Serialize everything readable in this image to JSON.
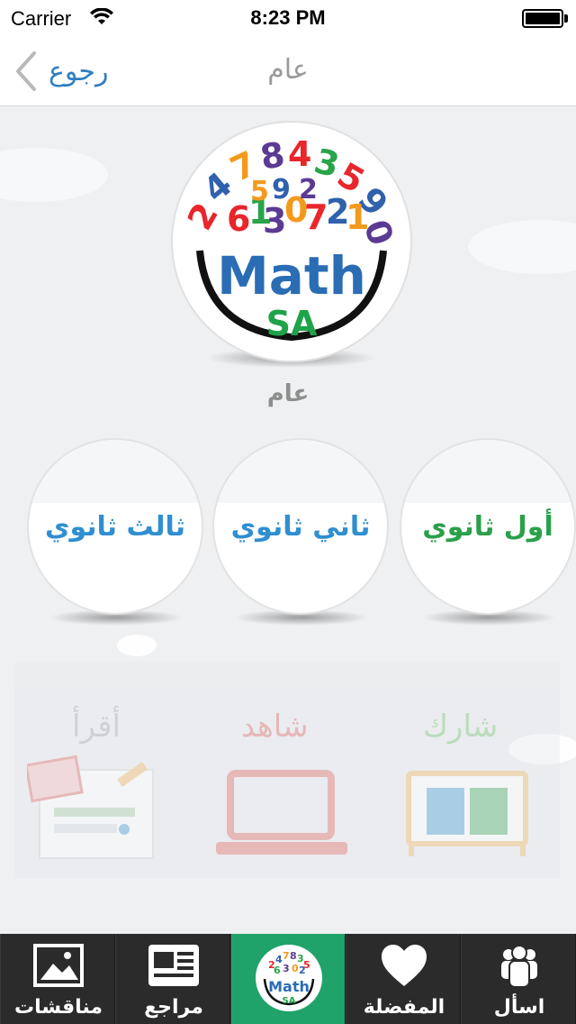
{
  "status_bar": {
    "carrier": "Carrier",
    "time": "8:23 PM"
  },
  "nav": {
    "back_label": "رجوع",
    "title": "عام"
  },
  "logo": {
    "math_text": "Math",
    "sa_text": "SA",
    "digits": "247843590"
  },
  "section_caption": "عام",
  "grades": [
    {
      "label": "ثالث ثانوي",
      "color": "#2f8fd1"
    },
    {
      "label": "ثاني ثانوي",
      "color": "#2f8fd1"
    },
    {
      "label": "أول ثانوي",
      "color": "#2ba04b"
    }
  ],
  "faded_features": [
    {
      "label": "أقرأ",
      "color": "#9a9a9a"
    },
    {
      "label": "شاهد",
      "color": "#d9534f"
    },
    {
      "label": "شارك",
      "color": "#5cb85c"
    }
  ],
  "tabbar": {
    "items": [
      {
        "label": "مناقشات",
        "icon": "image-icon"
      },
      {
        "label": "مراجع",
        "icon": "newspaper-icon"
      },
      {
        "label": "",
        "icon": "math-sa-logo-icon"
      },
      {
        "label": "المفضلة",
        "icon": "heart-icon"
      },
      {
        "label": "اسأل",
        "icon": "people-icon"
      }
    ],
    "active_color": "#1fa36b"
  }
}
